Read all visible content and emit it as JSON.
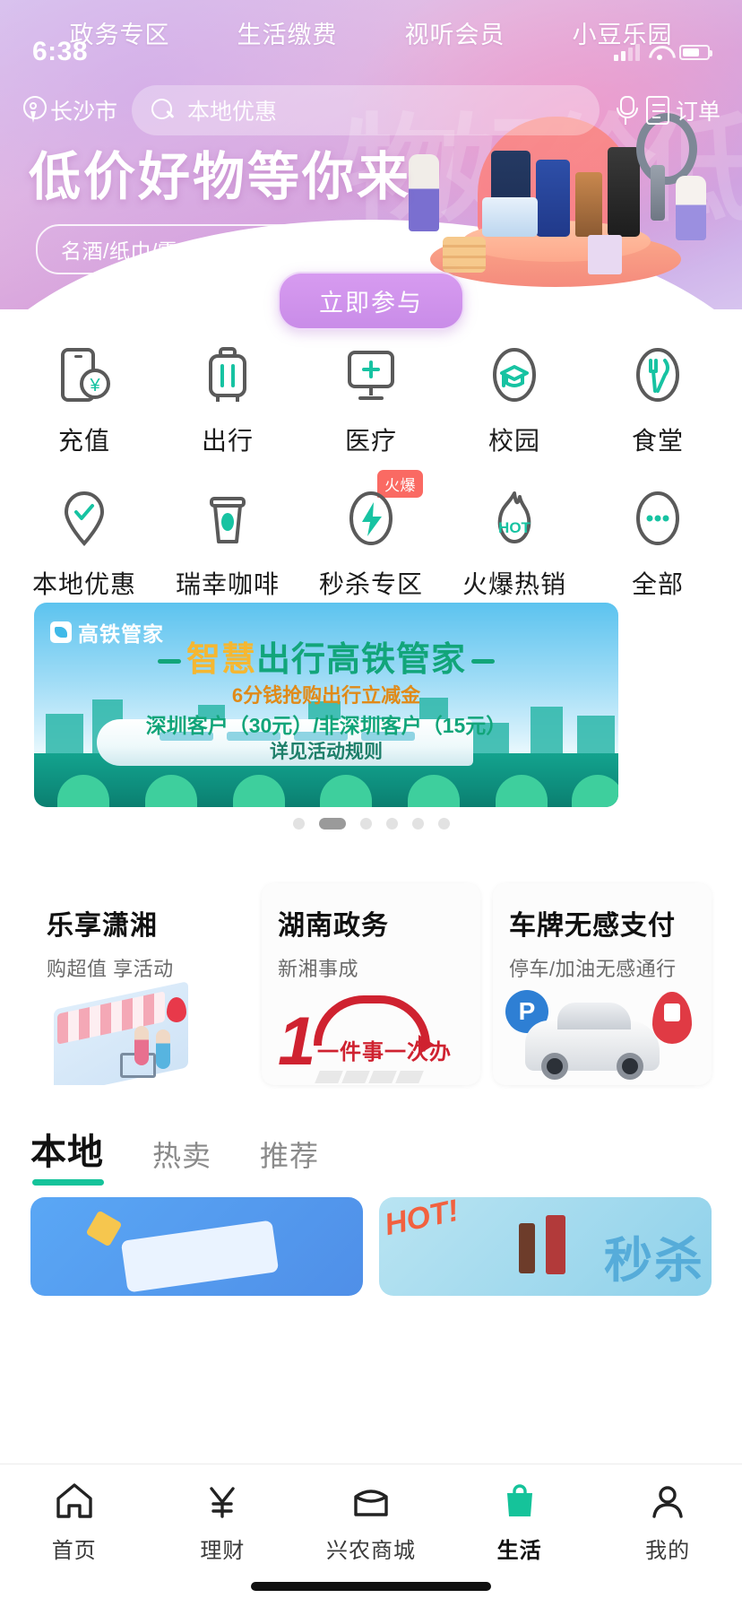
{
  "status_bar": {
    "time": "6:38",
    "wifi_icon": "wifi-icon",
    "signal_icon": "signal-icon",
    "battery_icon": "battery-icon"
  },
  "hero": {
    "top_tabs": [
      {
        "label": "政务专区"
      },
      {
        "label": "生活缴费"
      },
      {
        "label": "视听会员"
      },
      {
        "label": "小豆乐园"
      }
    ],
    "location": "长沙市",
    "location_icon": "location-pin-icon",
    "search_icon": "search-icon",
    "search_placeholder": "本地优惠",
    "mic_icon": "microphone-icon",
    "orders_icon": "order-list-icon",
    "orders_label": "订单",
    "title": "低价好物等你来",
    "subtitle": "名酒/纸巾/零食/戴森秒杀抢购不断",
    "cta_label": "立即参与",
    "ghost_text": "低价好物"
  },
  "quick_grid": {
    "rows": [
      [
        {
          "label": "充值",
          "icon": "phone-recharge-icon"
        },
        {
          "label": "出行",
          "icon": "suitcase-travel-icon"
        },
        {
          "label": "医疗",
          "icon": "medical-monitor-icon"
        },
        {
          "label": "校园",
          "icon": "graduation-cap-icon"
        },
        {
          "label": "食堂",
          "icon": "cutlery-canteen-icon"
        }
      ],
      [
        {
          "label": "本地优惠",
          "icon": "location-check-icon",
          "badge": ""
        },
        {
          "label": "瑞幸咖啡",
          "icon": "coffee-cup-icon",
          "badge": ""
        },
        {
          "label": "秒杀专区",
          "icon": "flash-bolt-icon",
          "badge": "火爆"
        },
        {
          "label": "火爆热销",
          "icon": "flame-hot-icon",
          "badge": ""
        },
        {
          "label": "全部",
          "icon": "more-dots-icon",
          "badge": ""
        }
      ]
    ]
  },
  "train_banner": {
    "logo_text": "高铁管家",
    "logo_icon": "train-app-logo-icon",
    "title_part1": "智慧",
    "title_part2": "出行",
    "title_part3": "高铁管家",
    "line1": "6分钱抢购出行立减金",
    "line2": "深圳客户（30元）/非深圳客户（15元）",
    "line3": "详见活动规则",
    "dots_total": 6,
    "dots_active_index": 1
  },
  "feature_cards": [
    {
      "title": "乐享潇湘",
      "subtitle": "购超值 享活动",
      "art": "shopping-illustration"
    },
    {
      "title": "湖南政务",
      "subtitle": "新湘事成",
      "art": "one-thing-one-time-illustration",
      "art_text": "一件事一次办",
      "art_number": "1"
    },
    {
      "title": "车牌无感支付",
      "subtitle": "停车/加油无感通行",
      "art": "car-plate-illustration",
      "parking_letter": "P"
    }
  ],
  "section_tabs": [
    {
      "label": "本地",
      "active": true
    },
    {
      "label": "热卖",
      "active": false
    },
    {
      "label": "推荐",
      "active": false
    }
  ],
  "product_tiles": [
    {
      "badge": "",
      "text": ""
    },
    {
      "badge": "HOT!",
      "text": "秒杀"
    }
  ],
  "tabbar": [
    {
      "label": "首页",
      "icon": "home-icon",
      "active": false
    },
    {
      "label": "理财",
      "icon": "yuan-finance-icon",
      "active": false
    },
    {
      "label": "兴农商城",
      "icon": "store-icon",
      "active": false
    },
    {
      "label": "生活",
      "icon": "shopping-bag-icon",
      "active": true
    },
    {
      "label": "我的",
      "icon": "user-profile-icon",
      "active": false
    }
  ],
  "colors": {
    "accent_green": "#15c39a",
    "badge_red": "#fa6a63",
    "hero_purple": "#d9a6dd"
  }
}
